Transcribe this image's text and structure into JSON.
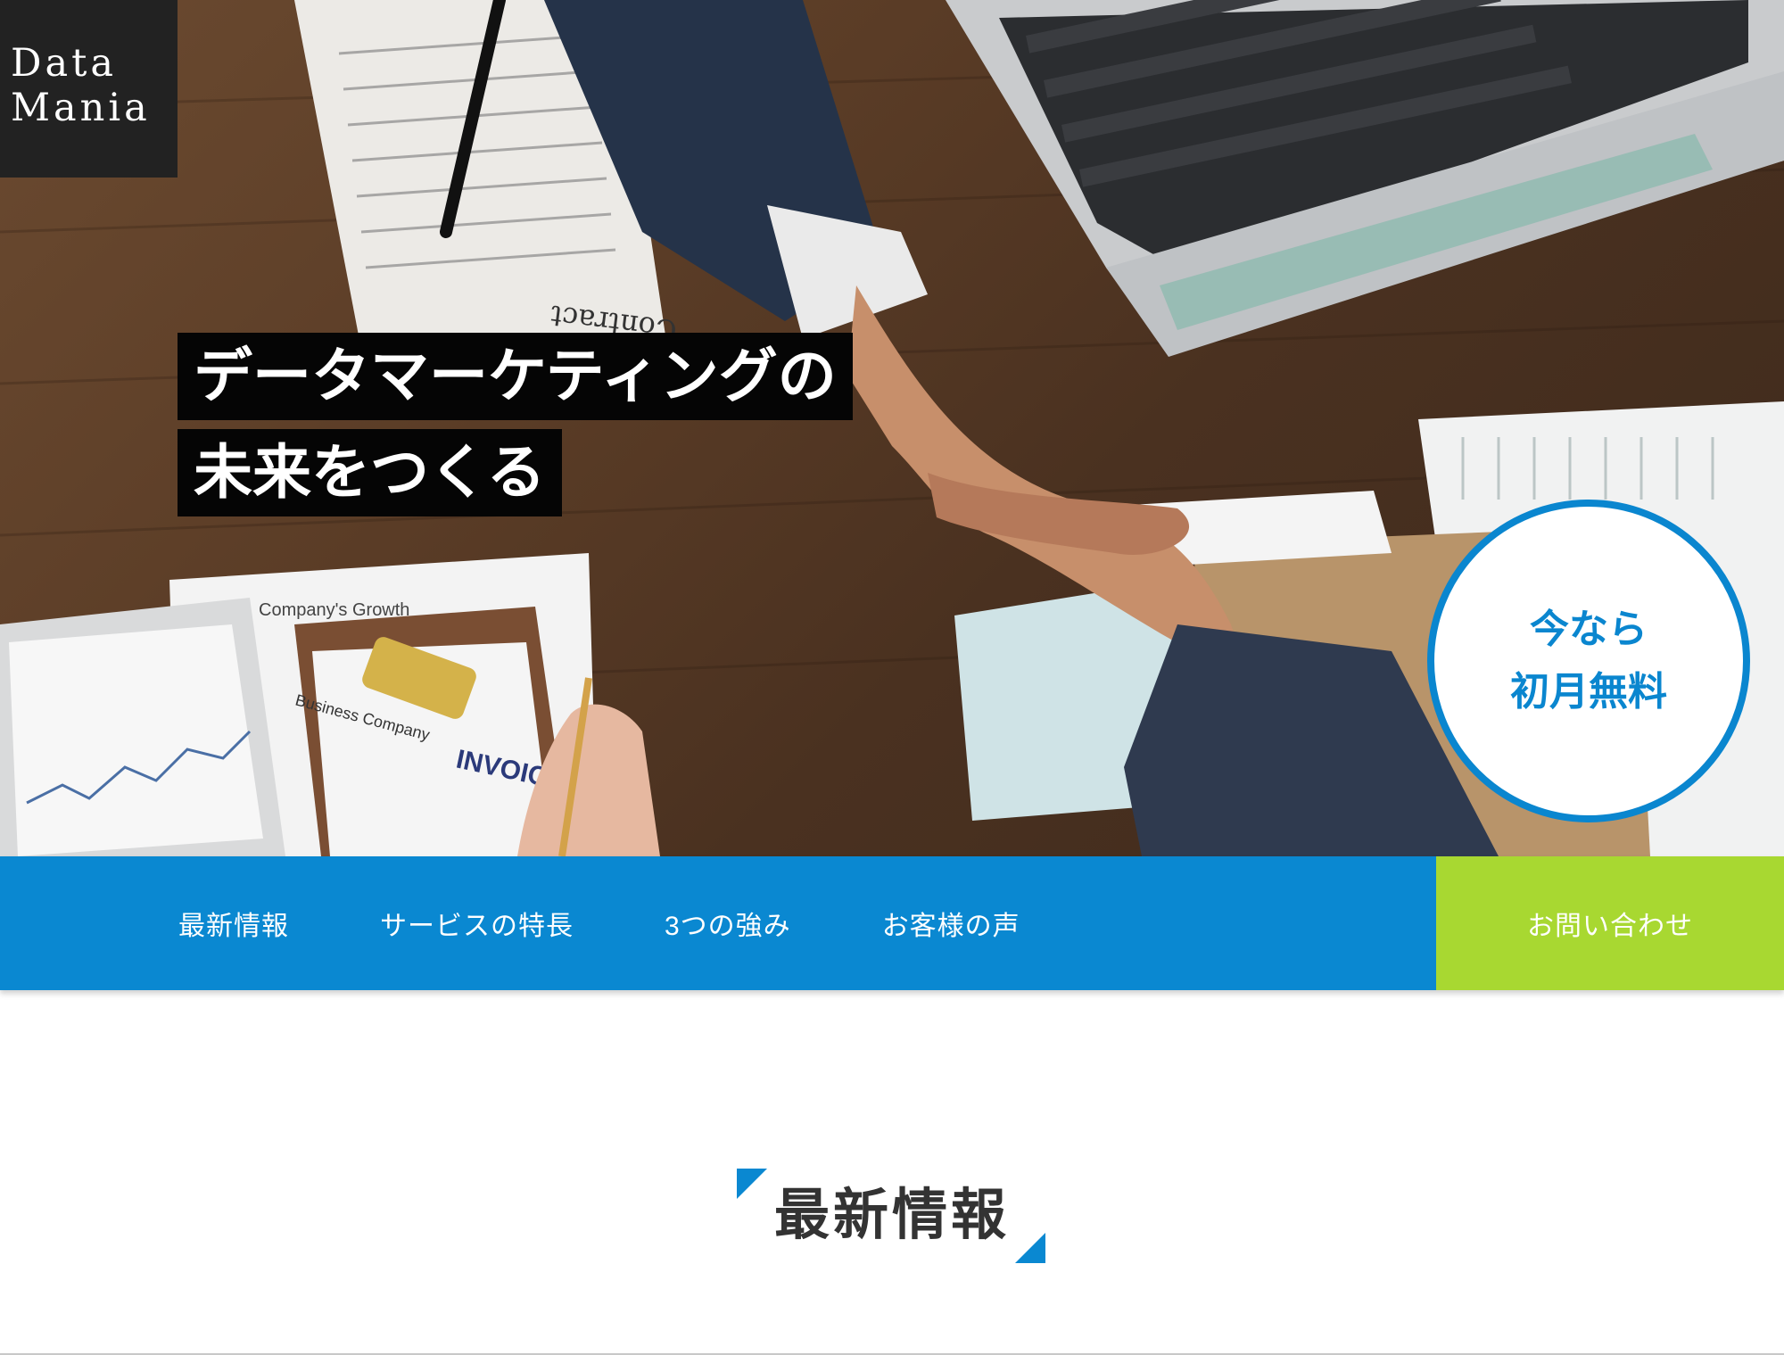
{
  "logo": {
    "line1": "Data",
    "line2": "Mania"
  },
  "hero": {
    "headline_line1": "データマーケティングの",
    "headline_line2": "未来をつくる",
    "photo_text": {
      "contract": "Contract",
      "growth": "Company's Growth",
      "invoice": "INVOICE",
      "business_company": "Business Company"
    },
    "badge": {
      "line1": "今なら",
      "line2": "初月無料"
    }
  },
  "nav": {
    "items": [
      {
        "label": "最新情報"
      },
      {
        "label": "サービスの特長"
      },
      {
        "label": "3つの強み"
      },
      {
        "label": "お客様の声"
      }
    ],
    "cta_label": "お問い合わせ"
  },
  "section": {
    "title": "最新情報"
  },
  "colors": {
    "primary_blue": "#0a88d1",
    "accent_green": "#a8d831",
    "logo_bg": "#222222",
    "heading_text": "#333333"
  }
}
